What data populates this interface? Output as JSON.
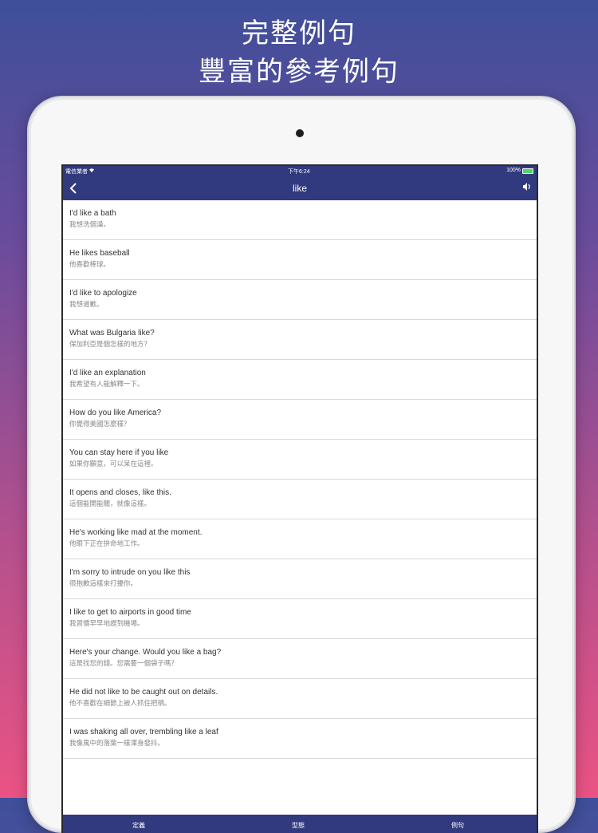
{
  "promo": {
    "line1": "完整例句",
    "line2": "豐富的參考例句"
  },
  "status_bar": {
    "carrier": "電信業者",
    "wifi_icon": "wifi-icon",
    "time": "下午6:24",
    "battery": "100%"
  },
  "nav": {
    "back_icon": "chevron-left-icon",
    "title": "like",
    "speaker_icon": "speaker-icon"
  },
  "sentences": [
    {
      "en": "I'd like a bath",
      "zh": "我想洗個澡。"
    },
    {
      "en": "He likes baseball",
      "zh": "他喜歡棒球。"
    },
    {
      "en": "I'd like to apologize",
      "zh": "我想道歉。"
    },
    {
      "en": "What was Bulgaria like?",
      "zh": "保加利亞是個怎樣的地方？"
    },
    {
      "en": "I'd like an explanation",
      "zh": "我希望有人能解釋一下。"
    },
    {
      "en": "How do you like America?",
      "zh": "你覺得美國怎麼樣？"
    },
    {
      "en": "You can stay here if you like",
      "zh": "如果你願意，可以呆在這裡。"
    },
    {
      "en": "It opens and closes, like this.",
      "zh": "這個能開能關，就像這樣。"
    },
    {
      "en": "He's working like mad at the moment.",
      "zh": "他眼下正在拚命地工作。"
    },
    {
      "en": "I'm sorry to intrude on you like this",
      "zh": "很抱歉這樣來打擾你。"
    },
    {
      "en": "I like to get to airports in good time",
      "zh": "我習慣早早地趕到機場。"
    },
    {
      "en": "Here's your change. Would you like a bag?",
      "zh": "這是找您的錢。您需要一個袋子嗎？"
    },
    {
      "en": "He did not like to be caught out on details.",
      "zh": "他不喜歡在細節上被人抓住把柄。"
    },
    {
      "en": "I was shaking all over, trembling like a leaf",
      "zh": "我像風中的落葉一樣渾身發抖。"
    }
  ],
  "tabs": [
    {
      "label": "定義"
    },
    {
      "label": "型態"
    },
    {
      "label": "例句"
    }
  ]
}
